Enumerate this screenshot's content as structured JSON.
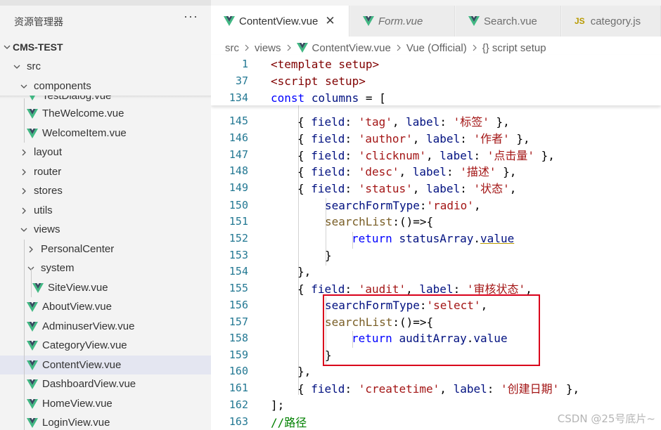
{
  "explorer": {
    "title": "资源管理器",
    "more": "···",
    "project": "CMS-TEST",
    "items": [
      {
        "label": "src",
        "type": "folder",
        "open": true
      },
      {
        "label": "components",
        "type": "folder",
        "open": true
      },
      {
        "label": "TestDialog.vue",
        "type": "vue"
      },
      {
        "label": "TheWelcome.vue",
        "type": "vue"
      },
      {
        "label": "WelcomeItem.vue",
        "type": "vue"
      },
      {
        "label": "layout",
        "type": "folder",
        "open": false
      },
      {
        "label": "router",
        "type": "folder",
        "open": false
      },
      {
        "label": "stores",
        "type": "folder",
        "open": false
      },
      {
        "label": "utils",
        "type": "folder",
        "open": false
      },
      {
        "label": "views",
        "type": "folder",
        "open": true
      },
      {
        "label": "PersonalCenter",
        "type": "folder",
        "open": false
      },
      {
        "label": "system",
        "type": "folder",
        "open": true
      },
      {
        "label": "SiteView.vue",
        "type": "vue"
      },
      {
        "label": "AboutView.vue",
        "type": "vue"
      },
      {
        "label": "AdminuserView.vue",
        "type": "vue"
      },
      {
        "label": "CategoryView.vue",
        "type": "vue"
      },
      {
        "label": "ContentView.vue",
        "type": "vue",
        "selected": true
      },
      {
        "label": "DashboardView.vue",
        "type": "vue"
      },
      {
        "label": "HomeView.vue",
        "type": "vue"
      },
      {
        "label": "LoginView.vue",
        "type": "vue"
      }
    ]
  },
  "tabs": [
    {
      "label": "ContentView.vue",
      "active": true,
      "close": "✕"
    },
    {
      "label": "Form.vue",
      "italic": true
    },
    {
      "label": "Search.vue"
    },
    {
      "label": "category.js",
      "icon": "JS"
    }
  ],
  "breadcrumb": [
    "src",
    "views",
    "ContentView.vue",
    "Vue (Official)",
    "{} script setup"
  ],
  "code": {
    "line1": {
      "n": "1",
      "text": "<template setup>"
    },
    "line37": {
      "n": "37",
      "text": "<script setup>"
    },
    "line134": {
      "n": "134",
      "kw": "const",
      "name": "columns",
      "rest": " = ["
    },
    "line145": {
      "n": "145",
      "field": "'tag'",
      "label": "'标签'"
    },
    "line146": {
      "n": "146",
      "field": "'author'",
      "label": "'作者'"
    },
    "line147": {
      "n": "147",
      "field": "'clicknum'",
      "label": "'点击量'"
    },
    "line148": {
      "n": "148",
      "field": "'desc'",
      "label": "'描述'"
    },
    "line149": {
      "n": "149",
      "field": "'status'",
      "label": "'状态'"
    },
    "line150": {
      "n": "150",
      "prop": "searchFormType",
      "val": "'radio'"
    },
    "line151": {
      "n": "151",
      "prop": "searchList"
    },
    "line152": {
      "n": "152",
      "kw": "return",
      "obj": "statusArray",
      "member": "value"
    },
    "line153": {
      "n": "153",
      "text": "}"
    },
    "line154": {
      "n": "154",
      "text": "},"
    },
    "line155": {
      "n": "155",
      "field": "'audit'",
      "label": "'审核状态'"
    },
    "line156": {
      "n": "156",
      "prop": "searchFormType",
      "val": "'select'"
    },
    "line157": {
      "n": "157",
      "prop": "searchList"
    },
    "line158": {
      "n": "158",
      "kw": "return",
      "obj": "auditArray",
      "member": "value"
    },
    "line159": {
      "n": "159",
      "text": "}"
    },
    "line160": {
      "n": "160",
      "text": "},"
    },
    "line161": {
      "n": "161",
      "field": "'createtime'",
      "label": "'创建日期'"
    },
    "line162": {
      "n": "162",
      "text": "];"
    },
    "line163": {
      "n": "163",
      "text": "//路径"
    },
    "kw_field": "field",
    "kw_label": "label"
  },
  "watermark": "CSDN @25号底片~",
  "colors": {
    "highlight": "#d9001b",
    "vue_green": "#41b883",
    "selected_row": "#e4e6f1"
  }
}
